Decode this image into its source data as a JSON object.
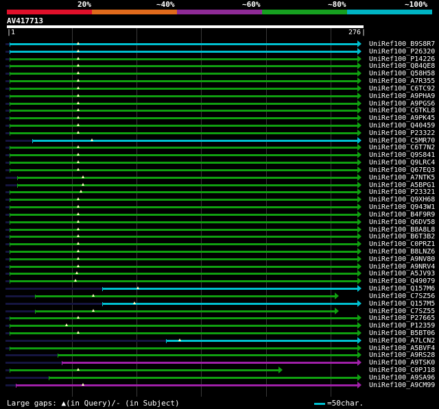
{
  "legend": {
    "labels": [
      "20%",
      "~40%",
      "~60%",
      "~80%",
      "~100%"
    ],
    "colors": [
      "#e0102a",
      "#e06a1c",
      "#8e2a96",
      "#16a020",
      "#00b4c4"
    ]
  },
  "query": {
    "name": "AV417713",
    "start": "1",
    "end": "276"
  },
  "hits": [
    {
      "name": "UniRef100_B9S8R7",
      "color": "#00c0d0",
      "qs": 2,
      "qe": 276,
      "arrow": true,
      "marker": 56
    },
    {
      "name": "UniRef100_P26320",
      "color": "#00c0d0",
      "qs": 2,
      "qe": 276,
      "arrow": true,
      "marker": 56
    },
    {
      "name": "UniRef100_P14226",
      "color": "#10a010",
      "qs": 2,
      "qe": 276,
      "arrow": true,
      "marker": 56
    },
    {
      "name": "UniRef100_Q84QE8",
      "color": "#10a010",
      "qs": 2,
      "qe": 276,
      "arrow": true,
      "marker": 56
    },
    {
      "name": "UniRef100_Q58H58",
      "color": "#10a010",
      "qs": 2,
      "qe": 276,
      "arrow": true,
      "marker": 56
    },
    {
      "name": "UniRef100_A7R355",
      "color": "#10a010",
      "qs": 2,
      "qe": 276,
      "arrow": true,
      "marker": 56
    },
    {
      "name": "UniRef100_C6TC92",
      "color": "#10a010",
      "qs": 2,
      "qe": 276,
      "arrow": true,
      "marker": 56
    },
    {
      "name": "UniRef100_A9PHA9",
      "color": "#10a010",
      "qs": 2,
      "qe": 276,
      "arrow": true,
      "marker": 56
    },
    {
      "name": "UniRef100_A9PGS6",
      "color": "#10a010",
      "qs": 2,
      "qe": 276,
      "arrow": true,
      "marker": 56
    },
    {
      "name": "UniRef100_C6TKL8",
      "color": "#10a010",
      "qs": 2,
      "qe": 276,
      "arrow": true,
      "marker": 56
    },
    {
      "name": "UniRef100_A9PK45",
      "color": "#10a010",
      "qs": 2,
      "qe": 276,
      "arrow": true,
      "marker": 56
    },
    {
      "name": "UniRef100_Q40459",
      "color": "#10a010",
      "qs": 2,
      "qe": 276,
      "arrow": true,
      "marker": 56
    },
    {
      "name": "UniRef100_P23322",
      "color": "#10a010",
      "qs": 2,
      "qe": 276,
      "arrow": true,
      "marker": 56
    },
    {
      "name": "UniRef100_C5MR70",
      "color": "#00c0d0",
      "qs": 20,
      "qe": 276,
      "arrow": true,
      "marker": 67
    },
    {
      "name": "UniRef100_C6T7N2",
      "color": "#10a010",
      "qs": 2,
      "qe": 276,
      "arrow": true,
      "marker": 56
    },
    {
      "name": "UniRef100_Q9S841",
      "color": "#10a010",
      "qs": 2,
      "qe": 276,
      "arrow": true,
      "marker": 56
    },
    {
      "name": "UniRef100_Q9LRC4",
      "color": "#10a010",
      "qs": 2,
      "qe": 276,
      "arrow": true,
      "marker": 56
    },
    {
      "name": "UniRef100_Q67EQ3",
      "color": "#10a010",
      "qs": 2,
      "qe": 276,
      "arrow": true,
      "marker": 56
    },
    {
      "name": "UniRef100_A7NTK5",
      "color": "#10a010",
      "qs": 8,
      "qe": 276,
      "arrow": true,
      "marker": 60
    },
    {
      "name": "UniRef100_A5BPG1",
      "color": "#10a010",
      "qs": 8,
      "qe": 276,
      "arrow": true,
      "marker": 60
    },
    {
      "name": "UniRef100_P23321",
      "color": "#10a010",
      "qs": 2,
      "qe": 276,
      "arrow": true,
      "marker": 58
    },
    {
      "name": "UniRef100_Q9XH68",
      "color": "#10a010",
      "qs": 2,
      "qe": 276,
      "arrow": true,
      "marker": 56
    },
    {
      "name": "UniRef100_Q943W1",
      "color": "#10a010",
      "qs": 2,
      "qe": 276,
      "arrow": true,
      "marker": 56
    },
    {
      "name": "UniRef100_B4F9R9",
      "color": "#10a010",
      "qs": 2,
      "qe": 276,
      "arrow": true,
      "marker": 56
    },
    {
      "name": "UniRef100_Q6DV58",
      "color": "#10a010",
      "qs": 2,
      "qe": 276,
      "arrow": true,
      "marker": 56
    },
    {
      "name": "UniRef100_B8A8L8",
      "color": "#10a010",
      "qs": 2,
      "qe": 276,
      "arrow": true,
      "marker": 56
    },
    {
      "name": "UniRef100_B6T3B2",
      "color": "#10a010",
      "qs": 2,
      "qe": 276,
      "arrow": true,
      "marker": 56
    },
    {
      "name": "UniRef100_C0PRZ1",
      "color": "#10a010",
      "qs": 2,
      "qe": 276,
      "arrow": true,
      "marker": 56
    },
    {
      "name": "UniRef100_B8LNZ6",
      "color": "#10a010",
      "qs": 2,
      "qe": 276,
      "arrow": true,
      "marker": 56
    },
    {
      "name": "UniRef100_A9NV80",
      "color": "#10a010",
      "qs": 2,
      "qe": 276,
      "arrow": true,
      "marker": 56
    },
    {
      "name": "UniRef100_A9NRV4",
      "color": "#10a010",
      "qs": 2,
      "qe": 276,
      "arrow": true,
      "marker": 56
    },
    {
      "name": "UniRef100_A5JV93",
      "color": "#10a010",
      "qs": 2,
      "qe": 276,
      "arrow": true,
      "marker": 55
    },
    {
      "name": "UniRef100_Q49079",
      "color": "#10a010",
      "qs": 2,
      "qe": 276,
      "arrow": true,
      "marker": 54
    },
    {
      "name": "UniRef100_Q157M6",
      "color": "#00c0d0",
      "qs": 75,
      "qe": 276,
      "arrow": true,
      "marker": 103
    },
    {
      "name": "UniRef100_C7SZ56",
      "color": "#10a010",
      "qs": 22,
      "qe": 258,
      "arrow": true,
      "marker": 68
    },
    {
      "name": "UniRef100_Q157M5",
      "color": "#00c0d0",
      "qs": 75,
      "qe": 276,
      "arrow": true,
      "marker": 100
    },
    {
      "name": "UniRef100_C7SZ55",
      "color": "#10a010",
      "qs": 22,
      "qe": 258,
      "arrow": true,
      "marker": 68
    },
    {
      "name": "UniRef100_P27665",
      "color": "#10a010",
      "qs": 2,
      "qe": 276,
      "arrow": true,
      "marker": 56
    },
    {
      "name": "UniRef100_P12359",
      "color": "#10a010",
      "qs": 2,
      "qe": 276,
      "arrow": true,
      "marker": 47
    },
    {
      "name": "UniRef100_B5BT06",
      "color": "#10a010",
      "qs": 2,
      "qe": 276,
      "arrow": true,
      "marker": 56
    },
    {
      "name": "UniRef100_A7LCN2",
      "color": "#00c0d0",
      "qs": 125,
      "qe": 276,
      "arrow": true,
      "marker": 136
    },
    {
      "name": "UniRef100_A5BVF4",
      "color": "#10a010",
      "qs": 2,
      "qe": 276,
      "arrow": true,
      "marker": null
    },
    {
      "name": "UniRef100_A9RS28",
      "color": "#10a010",
      "qs": 40,
      "qe": 276,
      "arrow": true,
      "marker": null
    },
    {
      "name": "UniRef100_A9TSK0",
      "color": "#a020a8",
      "qs": 43,
      "qe": 276,
      "arrow": true,
      "marker": null
    },
    {
      "name": "UniRef100_C0PJ18",
      "color": "#10a010",
      "qs": 2,
      "qe": 214,
      "arrow": true,
      "marker": 56
    },
    {
      "name": "UniRef100_A9SA96",
      "color": "#10a010",
      "qs": 33,
      "qe": 276,
      "arrow": true,
      "marker": null
    },
    {
      "name": "UniRef100_A9CM99",
      "color": "#a020a8",
      "qs": 7,
      "qe": 276,
      "arrow": true,
      "marker": 60
    }
  ],
  "footer": {
    "gaps": "Large gaps: ▲(in Query)/- (in Subject)",
    "scale": "=50char."
  }
}
